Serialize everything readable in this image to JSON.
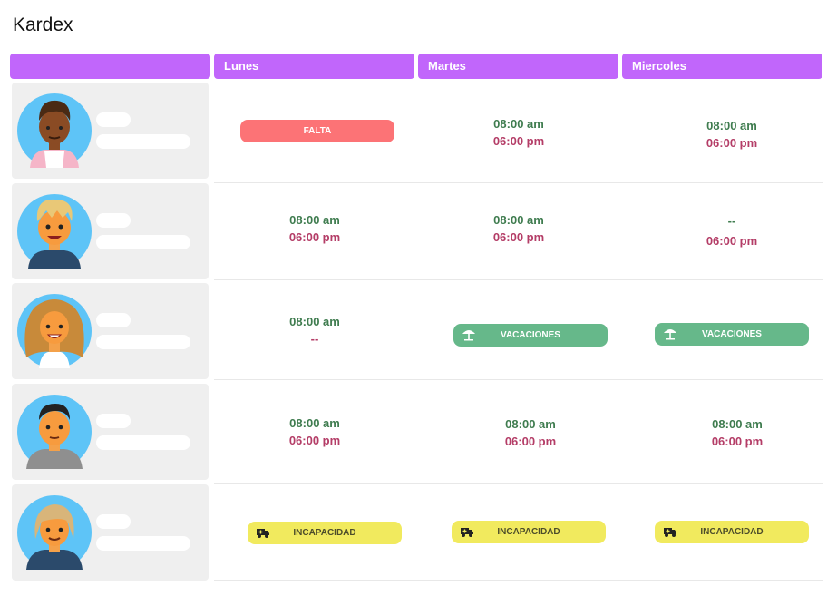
{
  "page": {
    "title": "Kardex"
  },
  "columns": [
    "",
    "Lunes",
    "Martes",
    "Miercoles"
  ],
  "rows": [
    {
      "avatar": "person-avatar-1",
      "lunes": {
        "type": "badge",
        "label": "FALTA",
        "style": "falta"
      },
      "martes": {
        "in": "08:00 am",
        "out": "06:00 pm"
      },
      "miercoles": {
        "in": "08:00 am",
        "out": "06:00 pm"
      }
    },
    {
      "avatar": "person-avatar-2",
      "lunes": {
        "in": "08:00 am",
        "out": "06:00 pm"
      },
      "martes": {
        "in": "08:00 am",
        "out": "06:00 pm"
      },
      "miercoles": {
        "in": "--",
        "out": "06:00 pm"
      }
    },
    {
      "avatar": "person-avatar-3",
      "lunes": {
        "in": "08:00 am",
        "out": "--"
      },
      "martes": {
        "type": "badge",
        "label": "VACACIONES",
        "style": "vac",
        "icon": "beach-umbrella-icon"
      },
      "miercoles": {
        "type": "badge",
        "label": "VACACIONES",
        "style": "vac",
        "icon": "beach-umbrella-icon"
      }
    },
    {
      "avatar": "person-avatar-4",
      "lunes": {
        "in": "08:00 am",
        "out": "06:00 pm"
      },
      "martes": {
        "in": "08:00 am",
        "out": "06:00 pm"
      },
      "miercoles": {
        "in": "08:00 am",
        "out": "06:00 pm"
      }
    },
    {
      "avatar": "person-avatar-5",
      "lunes": {
        "type": "badge",
        "label": "INCAPACIDAD",
        "style": "inc",
        "icon": "ambulance-icon"
      },
      "martes": {
        "type": "badge",
        "label": "INCAPACIDAD",
        "style": "inc",
        "icon": "ambulance-icon"
      },
      "miercoles": {
        "type": "badge",
        "label": "INCAPACIDAD",
        "style": "inc",
        "icon": "ambulance-icon"
      }
    }
  ],
  "colors": {
    "header": "#c166fb",
    "check_in": "#3f7c4f",
    "check_out": "#b43d67",
    "falta": "#fc7376",
    "vacaciones": "#66b88a",
    "incapacidad": "#f1ea5e",
    "avatar_bg": "#5ec4f7"
  }
}
